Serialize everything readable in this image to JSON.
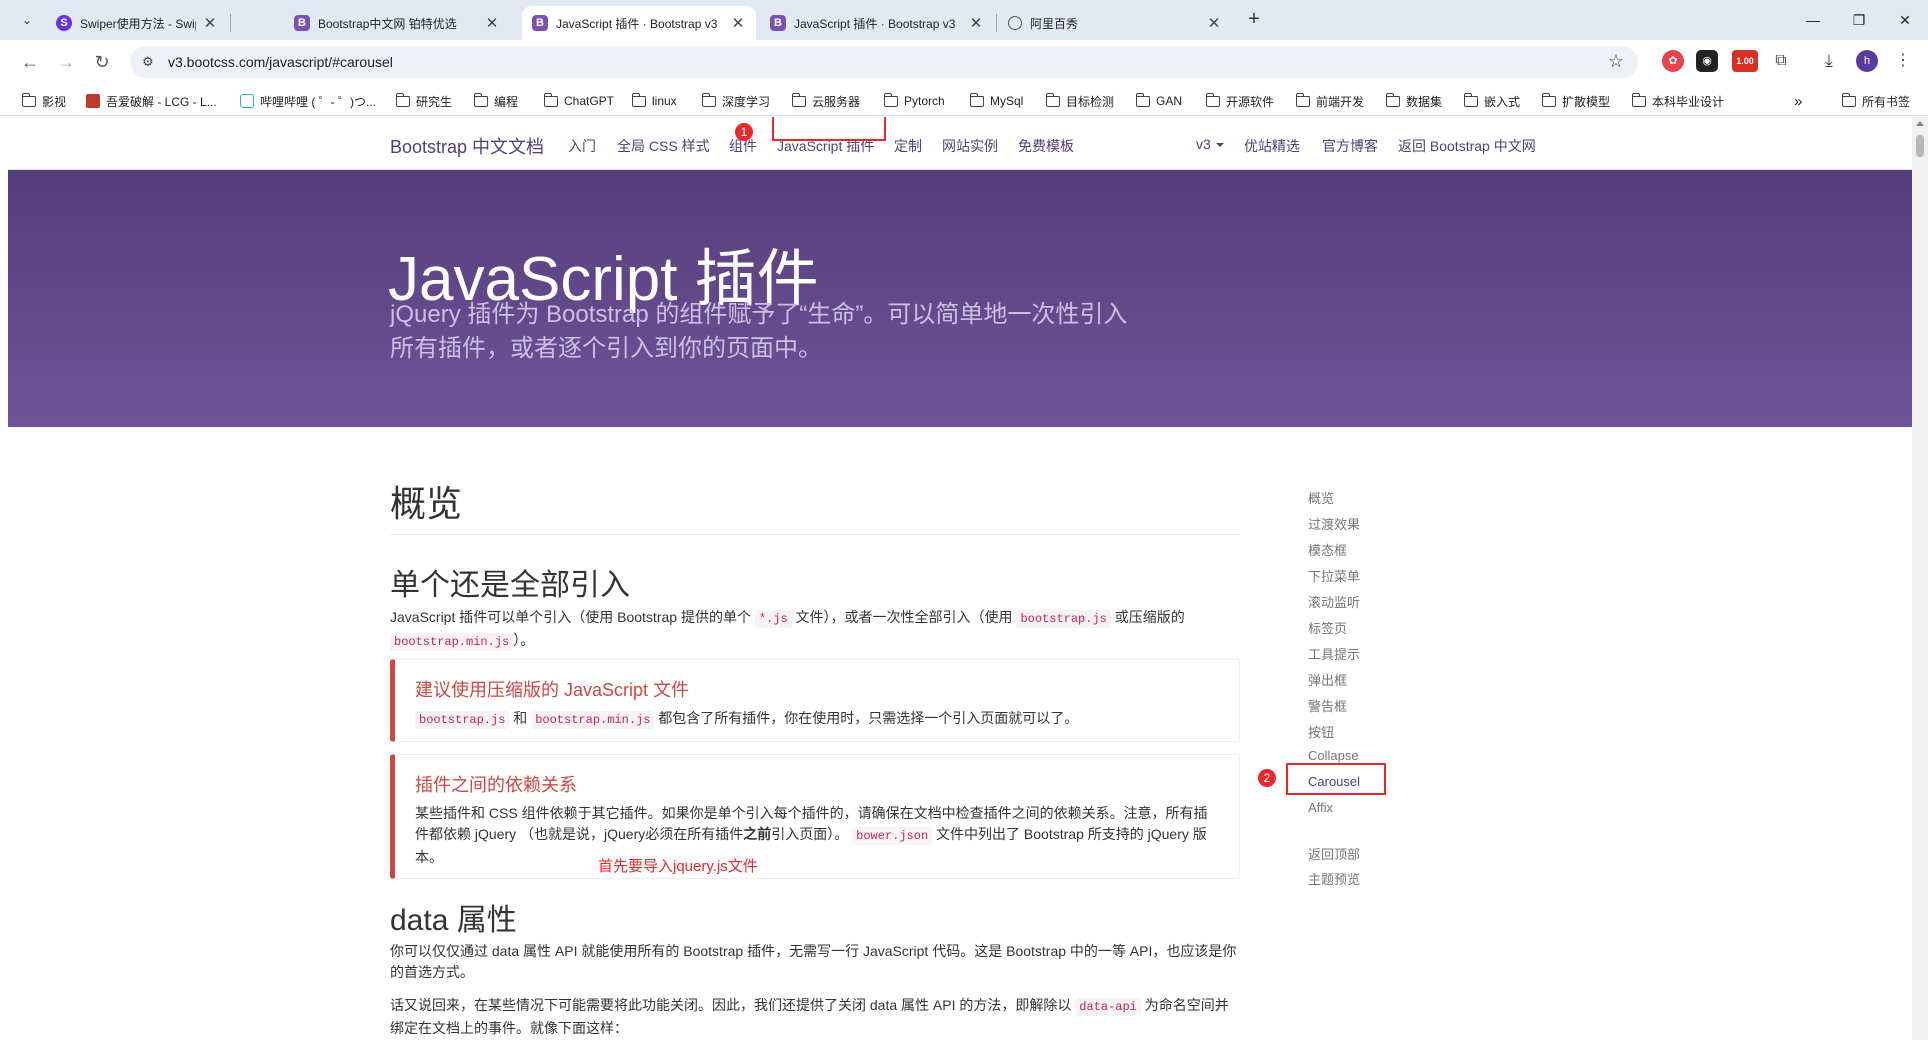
{
  "browser": {
    "tabs": [
      {
        "title": "Swiper使用方法 - Swiper中文网",
        "favicon": "S",
        "active": false
      },
      {
        "title": "Bootstrap中文网 铂特优选",
        "favicon": "B",
        "active": false
      },
      {
        "title": "JavaScript 插件 · Bootstrap v3",
        "favicon": "B",
        "active": true
      },
      {
        "title": "JavaScript 插件 · Bootstrap v3",
        "favicon": "B",
        "active": false
      },
      {
        "title": "阿里百秀",
        "favicon": "globe",
        "active": false
      }
    ],
    "url": "v3.bootcss.com/javascript/#carousel",
    "extension_badge": "1.00",
    "profile_initial": "h",
    "bookmarks": [
      {
        "label": "影视",
        "type": "folder"
      },
      {
        "label": "吾爱破解 - LCG - L...",
        "type": "site"
      },
      {
        "label": "哔哩哔哩 ( ゜- ゜)つ...",
        "type": "site"
      },
      {
        "label": "研究生",
        "type": "folder"
      },
      {
        "label": "编程",
        "type": "folder"
      },
      {
        "label": "ChatGPT",
        "type": "folder"
      },
      {
        "label": "linux",
        "type": "folder"
      },
      {
        "label": "深度学习",
        "type": "folder"
      },
      {
        "label": "云服务器",
        "type": "folder"
      },
      {
        "label": "Pytorch",
        "type": "folder"
      },
      {
        "label": "MySql",
        "type": "folder"
      },
      {
        "label": "目标检测",
        "type": "folder"
      },
      {
        "label": "GAN",
        "type": "folder"
      },
      {
        "label": "开源软件",
        "type": "folder"
      },
      {
        "label": "前端开发",
        "type": "folder"
      },
      {
        "label": "数据集",
        "type": "folder"
      },
      {
        "label": "嵌入式",
        "type": "folder"
      },
      {
        "label": "扩散模型",
        "type": "folder"
      },
      {
        "label": "本科毕业设计",
        "type": "folder"
      }
    ],
    "more_bookmarks": "»",
    "all_bookmarks": "所有书签"
  },
  "site_nav": {
    "brand": "Bootstrap 中文文档",
    "links": [
      "入门",
      "全局 CSS 样式",
      "组件",
      "JavaScript 插件",
      "定制",
      "网站实例",
      "免费模板"
    ],
    "version": "v3",
    "right_links": [
      "优站精选",
      "官方博客",
      "返回 Bootstrap 中文网"
    ]
  },
  "jumbotron": {
    "title": "JavaScript 插件",
    "subtitle": "jQuery 插件为 Bootstrap 的组件赋予了“生命”。可以简单地一次性引入所有插件，或者逐个引入到你的页面中。"
  },
  "content": {
    "overview_title": "概览",
    "section1_title": "单个还是全部引入",
    "section1_text_a": "JavaScript 插件可以单个引入（使用 Bootstrap 提供的单个 ",
    "section1_code1": "*.js",
    "section1_text_b": " 文件），或者一次性全部引入（使用 ",
    "section1_code2": "bootstrap.js",
    "section1_text_c": " 或压缩版的 ",
    "section1_code3": "bootstrap.min.js",
    "section1_text_d": "）。",
    "callout1_title": "建议使用压缩版的 JavaScript 文件",
    "callout1_code1": "bootstrap.js",
    "callout1_text_a": " 和 ",
    "callout1_code2": "bootstrap.min.js",
    "callout1_text_b": " 都包含了所有插件，你在使用时，只需选择一个引入页面就可以了。",
    "callout2_title": "插件之间的依赖关系",
    "callout2_text_a": "某些插件和 CSS 组件依赖于其它插件。如果你是单个引入每个插件的，请确保在文档中检查插件之间的依赖关系。注意，所有插件都依赖 jQuery （也就是说，jQuery必须在所有插件",
    "callout2_bold": "之前",
    "callout2_text_b": "引入页面）。 ",
    "callout2_code": "bower.json",
    "callout2_text_c": " 文件中列出了 Bootstrap 所支持的 jQuery 版本。",
    "annotation_text": "首先要导入jquery.js文件",
    "section2_title": "data 属性",
    "section2_p1": "你可以仅仅通过 data 属性 API 就能使用所有的 Bootstrap 插件，无需写一行 JavaScript 代码。这是 Bootstrap 中的一等 API，也应该是你的首选方式。",
    "section2_p2_a": "话又说回来，在某些情况下可能需要将此功能关闭。因此，我们还提供了关闭 data 属性 API 的方法，即解除以 ",
    "section2_p2_code": "data-api",
    "section2_p2_b": " 为命名空间并绑定在文档上的事件。就像下面这样："
  },
  "sidenav": {
    "items": [
      "概览",
      "过渡效果",
      "模态框",
      "下拉菜单",
      "滚动监听",
      "标签页",
      "工具提示",
      "弹出框",
      "警告框",
      "按钮",
      "Collapse",
      "Carousel",
      "Affix"
    ],
    "back_to_top": "返回顶部",
    "theme_preview": "主题预览"
  },
  "annotations": {
    "marker1": "1",
    "marker2": "2"
  },
  "colors": {
    "bootstrap_purple": "#563d7c",
    "annotation_red": "#e8282c",
    "callout_danger": "#ce4844"
  }
}
